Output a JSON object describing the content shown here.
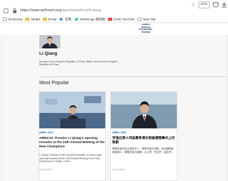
{
  "browser": {
    "url_domain": "https://www.weforum.org",
    "url_path": "/agenda/authors/li-qiang",
    "zoom": "67%"
  },
  "bookmarks": [
    {
      "label": "Dictionary",
      "icon": "dictionary-icon"
    },
    {
      "label": "Media",
      "icon": "folder-icon"
    },
    {
      "label": "Email",
      "icon": "email-icon"
    },
    {
      "label": "应用",
      "icon": "apps-icon"
    },
    {
      "label": "WhatsApp 網頁版",
      "icon": "whatsapp-icon"
    },
    {
      "label": "(126) YouTube",
      "icon": "youtube-icon"
    },
    {
      "label": "New Tab",
      "icon": "new-tab-icon"
    }
  ],
  "logo": {
    "line1": "WORLD",
    "line2": "ECONOMIC",
    "line3": "FORUM"
  },
  "profile": {
    "name": "Li Qiang",
    "bio": "Premier of the People's Republic of China, State Council of the People's Republic of China"
  },
  "section_title": "Most Popular",
  "cards": [
    {
      "tag": "AMNC 2023",
      "title": "AMNC23: Premier Li Qiang's opening remarks at the 14th Annual Meeting of the New Champions",
      "description": "Li Qiang, Premier of the People's Republic of China, gave opening remarks at the 14th Annual Meeting of the New Champions in Tianjin, China.",
      "date": "28 Jun 2023"
    },
    {
      "tag": "AMNC 2023",
      "title": "李強在第十四屆夏季達沃斯論壇開幕式上的致辭",
      "description": "尊敬的施瓦布主席和夫人，尊敬的各位貴賓，各位國際組織負責人，尊敬的各位使節，女士們、先生們、朋友們：",
      "date": "27 Jun 2023"
    }
  ],
  "colors": {
    "tag": "#0a5fa6",
    "logo": "#2b3a6b",
    "background": "#f7f7f7"
  }
}
